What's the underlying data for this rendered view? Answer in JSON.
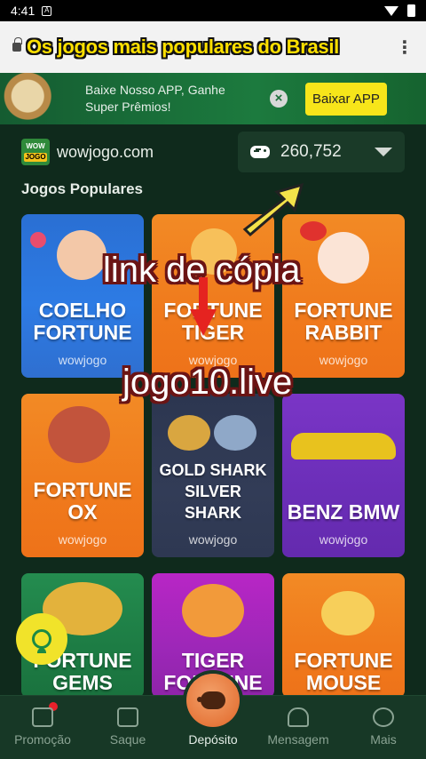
{
  "status_bar": {
    "time": "4:41"
  },
  "browser": {
    "overlay_title": "Os jogos mais populares do Brasil"
  },
  "promo_banner": {
    "text": "Baixe Nosso APP, Ganhe Super Prêmios!",
    "download_label": "Baixar APP"
  },
  "header": {
    "site_name": "wowjogo.com",
    "balance": "260,752",
    "logo_top": "WOW",
    "logo_bottom": "JOGO"
  },
  "section": {
    "title": "Jogos Populares"
  },
  "games": [
    {
      "title": "COELHO FORTUNE",
      "brand": "wowjogo",
      "color": "blue"
    },
    {
      "title": "FORTUNE TIGER",
      "brand": "wowjogo",
      "color": "orange"
    },
    {
      "title": "FORTUNE RABBIT",
      "brand": "wowjogo",
      "color": "orange"
    },
    {
      "title": "FORTUNE OX",
      "brand": "wowjogo",
      "color": "orange"
    },
    {
      "title": "GOLD SHARK SILVER SHARK",
      "brand": "wowjogo",
      "color": "gray"
    },
    {
      "title": "BENZ BMW",
      "brand": "wowjogo",
      "color": "purple"
    },
    {
      "title": "FORTUNE GEMS",
      "brand": "",
      "color": "green"
    },
    {
      "title": "TIGER FORTUNE",
      "brand": "",
      "color": "magenta"
    },
    {
      "title": "FORTUNE MOUSE",
      "brand": "",
      "color": "orange"
    }
  ],
  "overlays": {
    "copy_link": "link de cópia",
    "domain": "jogo10.live"
  },
  "bottom_nav": [
    {
      "label": "Promoção",
      "icon": "gift-icon"
    },
    {
      "label": "Saque",
      "icon": "wallet-icon"
    },
    {
      "label": "Depósito",
      "icon": "piggy-bank-icon"
    },
    {
      "label": "Mensagem",
      "icon": "bell-icon"
    },
    {
      "label": "Mais",
      "icon": "more-icon"
    }
  ],
  "colors": {
    "background": "#0f2a1c",
    "accent_yellow": "#f7e51a",
    "nav_bg": "#173826"
  }
}
